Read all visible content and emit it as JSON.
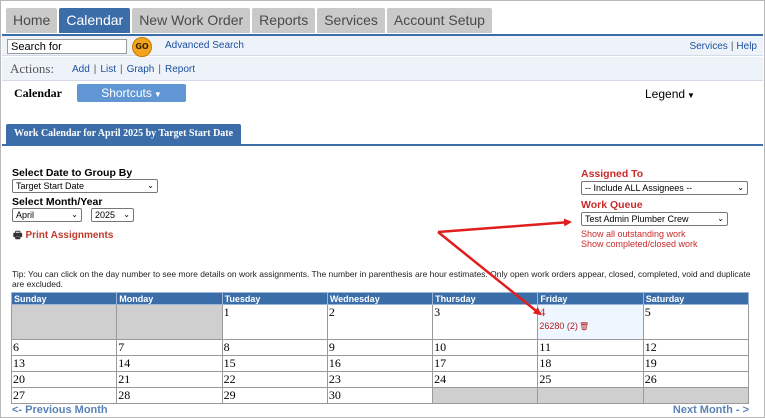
{
  "nav": {
    "tabs": [
      {
        "label": "Home"
      },
      {
        "label": "Calendar",
        "active": true
      },
      {
        "label": "New Work Order"
      },
      {
        "label": "Reports"
      },
      {
        "label": "Services"
      },
      {
        "label": "Account Setup"
      }
    ]
  },
  "search": {
    "value": "Search for",
    "go_label": "GO",
    "advanced_label": "Advanced Search"
  },
  "top_links": {
    "services": "Services",
    "help": "Help"
  },
  "actions": {
    "label": "Actions:",
    "add": "Add",
    "list": "List",
    "graph": "Graph",
    "report": "Report"
  },
  "calendar": {
    "heading": "Calendar",
    "shortcuts_label": "Shortcuts",
    "legend_label": "Legend"
  },
  "work_calendar_tab": "Work Calendar for April  2025 by Target Start Date",
  "filters": {
    "group_by_label": "Select Date to Group By",
    "group_by_value": "Target Start Date",
    "month_year_label": "Select Month/Year",
    "month_value": "April",
    "year_value": "2025",
    "print_label": "Print Assignments",
    "assigned_to_label": "Assigned To",
    "assigned_to_value": "-- Include ALL Assignees --",
    "work_queue_label": "Work Queue",
    "work_queue_value": "Test Admin Plumber Crew",
    "show_outstanding": "Show all outstanding work",
    "show_completed": "Show completed/closed work"
  },
  "tip": "Tip: You can click on the day number to see more details on work assignments. The number in parenthesis are hour estimates. Only open work orders appear, closed, completed, void and duplicate are excluded.",
  "grid": {
    "days": [
      "Sunday",
      "Monday",
      "Tuesday",
      "Wednesday",
      "Thursday",
      "Friday",
      "Saturday"
    ],
    "w1": {
      "tue": "1",
      "wed": "2",
      "thu": "3",
      "fri": "4",
      "fri_wo": "26280 (2)",
      "sat": "5"
    },
    "w2": [
      "6",
      "7",
      "8",
      "9",
      "10",
      "11",
      "12"
    ],
    "w3": [
      "13",
      "14",
      "15",
      "16",
      "17",
      "18",
      "19"
    ],
    "w4": [
      "20",
      "21",
      "22",
      "23",
      "24",
      "25",
      "26"
    ],
    "w5": [
      "27",
      "28",
      "29",
      "30"
    ]
  },
  "pager": {
    "prev": "<- Previous Month",
    "next": "Next Month - >"
  },
  "colors": {
    "accent": "#3b6da8",
    "alert": "#c92a2a",
    "arrow": "#e01e1e"
  }
}
